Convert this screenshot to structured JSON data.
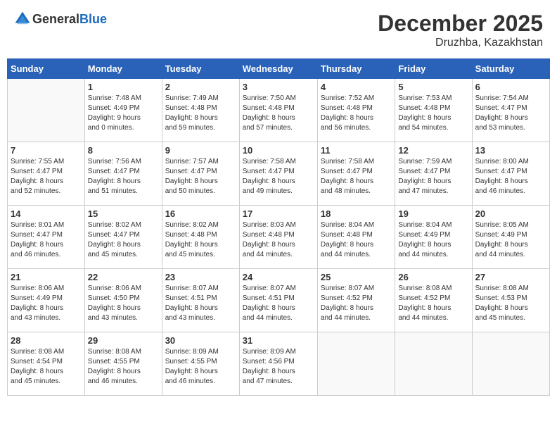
{
  "header": {
    "logo_general": "General",
    "logo_blue": "Blue",
    "month_title": "December 2025",
    "location": "Druzhba, Kazakhstan"
  },
  "days_of_week": [
    "Sunday",
    "Monday",
    "Tuesday",
    "Wednesday",
    "Thursday",
    "Friday",
    "Saturday"
  ],
  "weeks": [
    [
      {
        "day": "",
        "info": ""
      },
      {
        "day": "1",
        "info": "Sunrise: 7:48 AM\nSunset: 4:49 PM\nDaylight: 9 hours\nand 0 minutes."
      },
      {
        "day": "2",
        "info": "Sunrise: 7:49 AM\nSunset: 4:48 PM\nDaylight: 8 hours\nand 59 minutes."
      },
      {
        "day": "3",
        "info": "Sunrise: 7:50 AM\nSunset: 4:48 PM\nDaylight: 8 hours\nand 57 minutes."
      },
      {
        "day": "4",
        "info": "Sunrise: 7:52 AM\nSunset: 4:48 PM\nDaylight: 8 hours\nand 56 minutes."
      },
      {
        "day": "5",
        "info": "Sunrise: 7:53 AM\nSunset: 4:48 PM\nDaylight: 8 hours\nand 54 minutes."
      },
      {
        "day": "6",
        "info": "Sunrise: 7:54 AM\nSunset: 4:47 PM\nDaylight: 8 hours\nand 53 minutes."
      }
    ],
    [
      {
        "day": "7",
        "info": "Sunrise: 7:55 AM\nSunset: 4:47 PM\nDaylight: 8 hours\nand 52 minutes."
      },
      {
        "day": "8",
        "info": "Sunrise: 7:56 AM\nSunset: 4:47 PM\nDaylight: 8 hours\nand 51 minutes."
      },
      {
        "day": "9",
        "info": "Sunrise: 7:57 AM\nSunset: 4:47 PM\nDaylight: 8 hours\nand 50 minutes."
      },
      {
        "day": "10",
        "info": "Sunrise: 7:58 AM\nSunset: 4:47 PM\nDaylight: 8 hours\nand 49 minutes."
      },
      {
        "day": "11",
        "info": "Sunrise: 7:58 AM\nSunset: 4:47 PM\nDaylight: 8 hours\nand 48 minutes."
      },
      {
        "day": "12",
        "info": "Sunrise: 7:59 AM\nSunset: 4:47 PM\nDaylight: 8 hours\nand 47 minutes."
      },
      {
        "day": "13",
        "info": "Sunrise: 8:00 AM\nSunset: 4:47 PM\nDaylight: 8 hours\nand 46 minutes."
      }
    ],
    [
      {
        "day": "14",
        "info": "Sunrise: 8:01 AM\nSunset: 4:47 PM\nDaylight: 8 hours\nand 46 minutes."
      },
      {
        "day": "15",
        "info": "Sunrise: 8:02 AM\nSunset: 4:47 PM\nDaylight: 8 hours\nand 45 minutes."
      },
      {
        "day": "16",
        "info": "Sunrise: 8:02 AM\nSunset: 4:48 PM\nDaylight: 8 hours\nand 45 minutes."
      },
      {
        "day": "17",
        "info": "Sunrise: 8:03 AM\nSunset: 4:48 PM\nDaylight: 8 hours\nand 44 minutes."
      },
      {
        "day": "18",
        "info": "Sunrise: 8:04 AM\nSunset: 4:48 PM\nDaylight: 8 hours\nand 44 minutes."
      },
      {
        "day": "19",
        "info": "Sunrise: 8:04 AM\nSunset: 4:49 PM\nDaylight: 8 hours\nand 44 minutes."
      },
      {
        "day": "20",
        "info": "Sunrise: 8:05 AM\nSunset: 4:49 PM\nDaylight: 8 hours\nand 44 minutes."
      }
    ],
    [
      {
        "day": "21",
        "info": "Sunrise: 8:06 AM\nSunset: 4:49 PM\nDaylight: 8 hours\nand 43 minutes."
      },
      {
        "day": "22",
        "info": "Sunrise: 8:06 AM\nSunset: 4:50 PM\nDaylight: 8 hours\nand 43 minutes."
      },
      {
        "day": "23",
        "info": "Sunrise: 8:07 AM\nSunset: 4:51 PM\nDaylight: 8 hours\nand 43 minutes."
      },
      {
        "day": "24",
        "info": "Sunrise: 8:07 AM\nSunset: 4:51 PM\nDaylight: 8 hours\nand 44 minutes."
      },
      {
        "day": "25",
        "info": "Sunrise: 8:07 AM\nSunset: 4:52 PM\nDaylight: 8 hours\nand 44 minutes."
      },
      {
        "day": "26",
        "info": "Sunrise: 8:08 AM\nSunset: 4:52 PM\nDaylight: 8 hours\nand 44 minutes."
      },
      {
        "day": "27",
        "info": "Sunrise: 8:08 AM\nSunset: 4:53 PM\nDaylight: 8 hours\nand 45 minutes."
      }
    ],
    [
      {
        "day": "28",
        "info": "Sunrise: 8:08 AM\nSunset: 4:54 PM\nDaylight: 8 hours\nand 45 minutes."
      },
      {
        "day": "29",
        "info": "Sunrise: 8:08 AM\nSunset: 4:55 PM\nDaylight: 8 hours\nand 46 minutes."
      },
      {
        "day": "30",
        "info": "Sunrise: 8:09 AM\nSunset: 4:55 PM\nDaylight: 8 hours\nand 46 minutes."
      },
      {
        "day": "31",
        "info": "Sunrise: 8:09 AM\nSunset: 4:56 PM\nDaylight: 8 hours\nand 47 minutes."
      },
      {
        "day": "",
        "info": ""
      },
      {
        "day": "",
        "info": ""
      },
      {
        "day": "",
        "info": ""
      }
    ]
  ]
}
